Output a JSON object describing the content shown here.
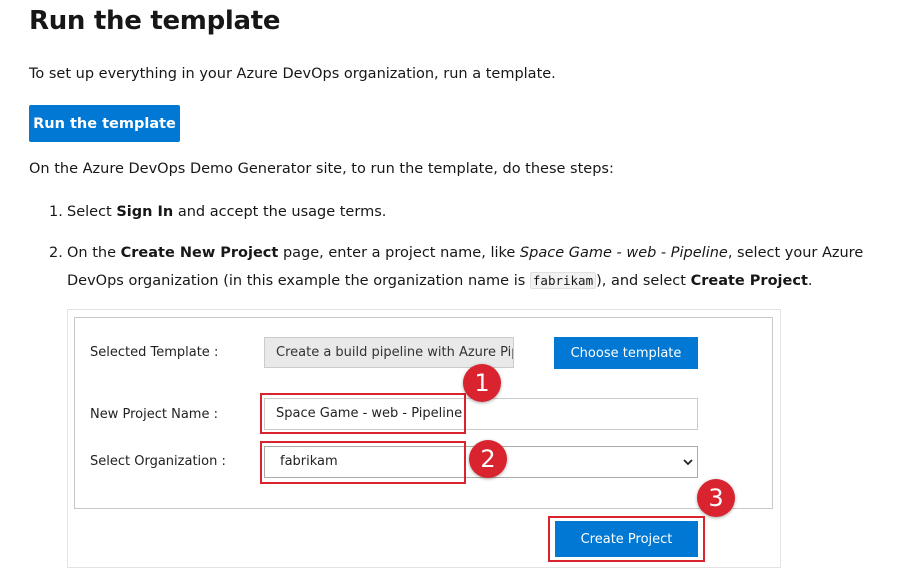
{
  "heading": "Run the template",
  "intro": "To set up everything in your Azure DevOps organization, run a template.",
  "run_button_label": "Run the template",
  "steps_intro": "On the Azure DevOps Demo Generator site, to run the template, do these steps:",
  "steps": [
    {
      "number": "1.",
      "parts": [
        "Select ",
        "Sign In",
        " and accept the usage terms."
      ]
    },
    {
      "number": "2.",
      "parts": [
        "On the ",
        "Create New Project",
        " page, enter a project name, like ",
        "Space Game - web - Pipeline",
        ", select your Azure DevOps organization (in this example the organization name is ",
        "fabrikam",
        "), and select ",
        "Create Project",
        "."
      ]
    }
  ],
  "screenshot": {
    "selected_template_label": "Selected Template :",
    "selected_template_value": "Create a build pipeline with Azure Pipelines",
    "choose_template_label": "Choose template",
    "project_name_label": "New Project Name :",
    "project_name_value": "Space Game - web - Pipeline",
    "organization_label": "Select Organization :",
    "organization_value": "fabrikam",
    "create_project_label": "Create Project",
    "callouts": [
      "1",
      "2",
      "3"
    ]
  },
  "colors": {
    "accent": "#0078d4",
    "callout": "#d9232e"
  },
  "icons": {
    "select_chevron": "chevron-down-icon"
  }
}
